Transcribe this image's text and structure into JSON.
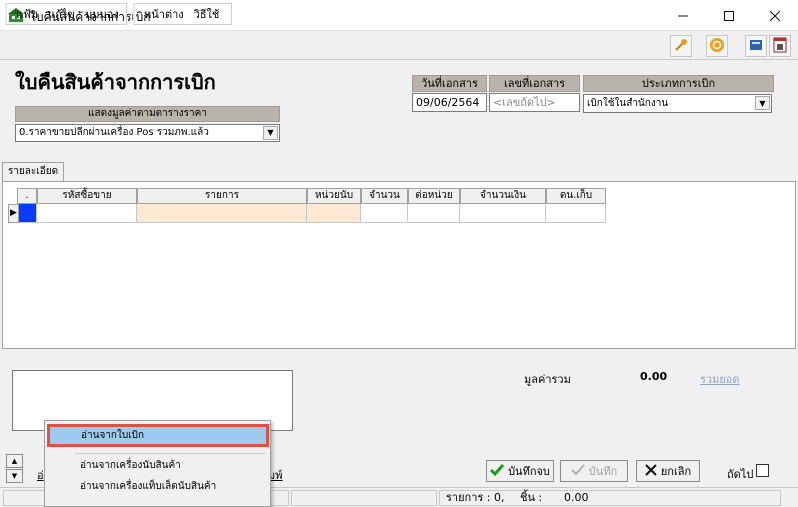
{
  "window": {
    "title": "ใบคืนสินค้าจากการเบิก"
  },
  "menu": {
    "file": "แฟ้ม",
    "edit": "แก้ไข",
    "view": "มุมมอง",
    "window": "หน้าต่าง",
    "help": "วิธีใช้"
  },
  "header": {
    "heading": "ใบคืนสินค้าจากการเบิก",
    "price_table_label": "แสดงมูลค่าตามตารางราคา",
    "price_table_value": "0.ราคาขายปลีกผ่านเครื่อง Pos รวมภพ.แล้ว",
    "doc_date_label": "วันที่เอกสาร",
    "doc_date_value": "09/06/2564",
    "doc_no_label": "เลขที่เอกสาร",
    "doc_no_placeholder": "<เลขถัดไป>",
    "withdraw_type_label": "ประเภทการเบิก",
    "withdraw_type_value": "เบิกใช้ในสำนักงาน"
  },
  "tabs": [
    {
      "label": "รายละเอียด"
    }
  ],
  "grid": {
    "columns": [
      {
        "label": "."
      },
      {
        "label": "รหัสซื้อขาย"
      },
      {
        "label": "รายการ"
      },
      {
        "label": "หน่วยนับ"
      },
      {
        "label": "จำนวน"
      },
      {
        "label": "ต่อหน่วย"
      },
      {
        "label": "จำนวนเงิน"
      },
      {
        "label": "ตน.เก็บ"
      }
    ]
  },
  "totals": {
    "label": "มูลค่ารวม",
    "value": "0.00",
    "sum_link": "รวมยอด"
  },
  "partial_links": {
    "left": "อ่",
    "right": "มพ์"
  },
  "actions": {
    "save_close": "บันทึกจบ",
    "save": "บันทึก",
    "cancel": "ยกเลิก",
    "next": "ถัดไป"
  },
  "status": {
    "items_label": "รายการ : 0,",
    "qty_label": "ชิ้น :",
    "qty_value": "0.00"
  },
  "popup_menu": {
    "items": [
      {
        "label": "อ่านจากใบเบิก"
      },
      {
        "label": "อ่านจากเครื่องนับสินค้า"
      },
      {
        "label": "อ่านจากเครื่องแท็บเล็ตนับสินค้า"
      }
    ]
  },
  "colors": {
    "label_bg": "#b8b4ab",
    "link_disabled": "#8ea4c0",
    "highlight_bg": "#9fc9ee",
    "highlight_border": "#e0504a",
    "selected_cell": "#0a3cff"
  }
}
